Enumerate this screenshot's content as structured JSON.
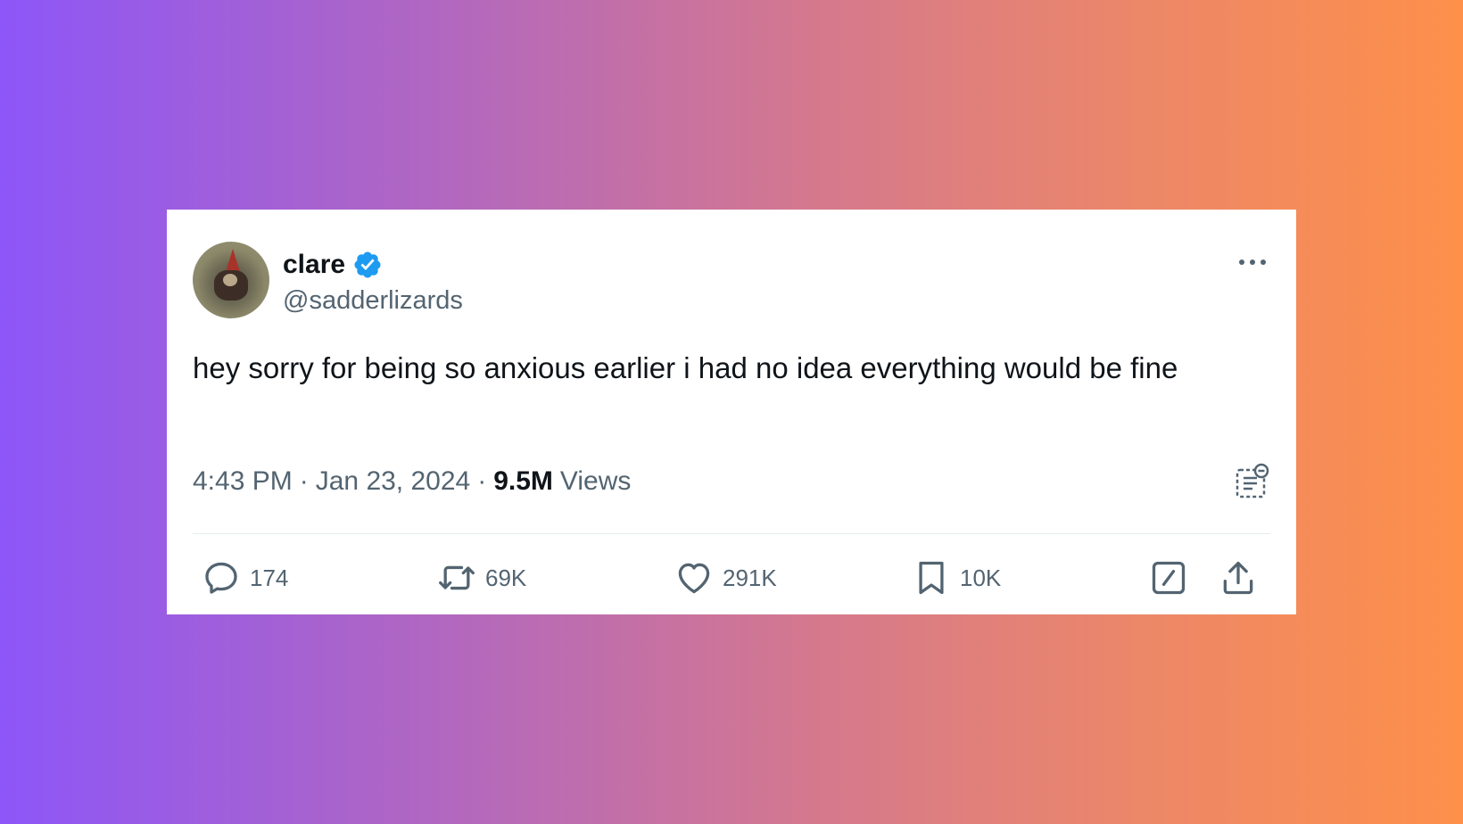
{
  "tweet": {
    "author": {
      "name": "clare",
      "handle": "@sadderlizards",
      "verified": true,
      "avatar_icon": "avatar-image"
    },
    "text": "hey sorry for being so anxious earlier i had no idea everything would be fine",
    "time": "4:43 PM",
    "date": "Jan 23, 2024",
    "separator": "·",
    "views_count": "9.5M",
    "views_label": "Views",
    "more_icon": "more-horizontal-icon"
  },
  "actions": {
    "replies": "174",
    "retweets": "69K",
    "likes": "291K",
    "bookmarks": "10K"
  },
  "colors": {
    "verified_badge": "#1d9bf0",
    "secondary_text": "#536471",
    "primary_text": "#0f1419",
    "gradient_start": "#8d56f8",
    "gradient_end": "#fe904a"
  }
}
